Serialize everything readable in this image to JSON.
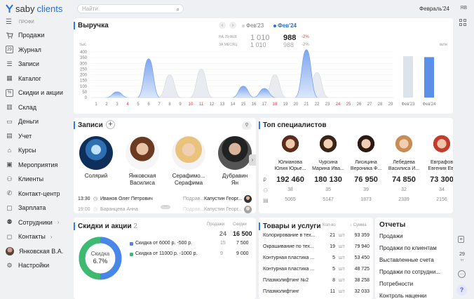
{
  "app": {
    "logo_text": "saby",
    "logo_brand": "clients"
  },
  "sidebar": {
    "section": "ПРОФИ",
    "items": [
      {
        "label": "Продажи",
        "icon": "cart-icon"
      },
      {
        "label": "Журнал",
        "icon": "calendar-icon",
        "badge": "29"
      },
      {
        "label": "Записи",
        "icon": "notes-icon"
      },
      {
        "label": "Каталог",
        "icon": "catalog-icon"
      },
      {
        "label": "Скидки и акции",
        "icon": "percent-icon"
      },
      {
        "label": "Склад",
        "icon": "warehouse-icon"
      },
      {
        "label": "Деньги",
        "icon": "wallet-icon"
      },
      {
        "label": "Учет",
        "icon": "ledger-icon"
      },
      {
        "label": "Курсы",
        "icon": "graduation-icon"
      },
      {
        "label": "Мероприятия",
        "icon": "events-icon"
      },
      {
        "label": "Клиенты",
        "icon": "clients-icon"
      },
      {
        "label": "Контакт-центр",
        "icon": "contact-center-icon"
      },
      {
        "label": "Зарплата",
        "icon": "salary-icon"
      },
      {
        "label": "Сотрудники",
        "icon": "employees-icon",
        "arrow": "›"
      },
      {
        "label": "Контакты",
        "icon": "chat-icon",
        "arrow": "›"
      },
      {
        "label": "Янковская В.А.",
        "icon": "user-avatar"
      },
      {
        "label": "Настройки",
        "icon": "gear-icon"
      }
    ]
  },
  "topbar": {
    "search_placeholder": "Найти",
    "period": "Февраль'24",
    "user_initials": "ЯВ"
  },
  "revenue": {
    "title": "Выручка",
    "legend": [
      "Фев'23",
      "Фев'24"
    ],
    "colors": {
      "prev": "#dde3ea",
      "curr": "#5b8fe8"
    },
    "rows": [
      {
        "label": "НА 29.ФЕВ",
        "prev": "1 010",
        "curr": "988",
        "delta": "-2%"
      },
      {
        "label": "ЗА МЕСЯЦ",
        "prev": "1 010",
        "curr": "988",
        "delta": "-2%"
      }
    ],
    "unit_left": "тыс",
    "unit_right": "млн",
    "bar_labels": [
      "Фев'23",
      "Фев'24"
    ]
  },
  "chart_data": {
    "type": "area",
    "x": [
      1,
      2,
      3,
      4,
      5,
      6,
      7,
      8,
      9,
      10,
      11,
      12,
      13,
      14,
      15,
      16,
      17,
      18,
      19,
      20,
      21,
      22,
      23,
      24,
      25,
      26,
      27,
      28,
      29
    ],
    "red_days": [
      4,
      10,
      11,
      17,
      18,
      24,
      25
    ],
    "series": [
      {
        "name": "Фев'24",
        "values": [
          0,
          0,
          50,
          0,
          0,
          340,
          0,
          0,
          0,
          0,
          0,
          0,
          0,
          0,
          100,
          0,
          80,
          0,
          0,
          0,
          420,
          0,
          0,
          0,
          0,
          0,
          0,
          0,
          0
        ]
      },
      {
        "name": "Фев'23",
        "values": [
          0,
          0,
          0,
          0,
          0,
          0,
          0,
          200,
          0,
          0,
          250,
          0,
          0,
          0,
          0,
          0,
          0,
          200,
          0,
          0,
          0,
          220,
          0,
          0,
          0,
          0,
          0,
          0,
          0
        ]
      }
    ],
    "ylim": [
      0,
      400
    ],
    "yticks": [
      0,
      50,
      100,
      150,
      200,
      250,
      300,
      350,
      400
    ],
    "bars": {
      "categories": [
        "Фев'23",
        "Фев'24"
      ],
      "values": [
        1.01,
        0.988
      ]
    }
  },
  "records": {
    "title": "Записи",
    "people": [
      {
        "name1": "Солярий",
        "name2": ""
      },
      {
        "name1": "Янковская",
        "name2": "Василиса"
      },
      {
        "name1": "Серафимо...",
        "name2": "Серафима"
      },
      {
        "name1": "Дубравин",
        "name2": "Ян"
      }
    ],
    "appointments": [
      {
        "time": "13:30",
        "client": "Иванов Олег Петрович",
        "service": "Подрав...",
        "master": "Капустин Георг..."
      },
      {
        "time": "19:00",
        "client": "Баранцева Анна",
        "service": "Подрав...",
        "master": "Капустин Георг..."
      }
    ]
  },
  "top": {
    "title": "Топ специалистов",
    "specialists": [
      {
        "last": "Юлианова",
        "first": "Юлия Юрье...",
        "money": "192 460",
        "clients": "38",
        "items": "5065"
      },
      {
        "last": "Чурсина",
        "first": "Марина Ива...",
        "money": "180 130",
        "clients": "35",
        "items": "5147"
      },
      {
        "last": "Лисицина",
        "first": "Вероника Ф...",
        "money": "76 950",
        "clients": "39",
        "items": "1873"
      },
      {
        "last": "Лебедева",
        "first": "Василиса И...",
        "money": "74 850",
        "clients": "32",
        "items": "2339"
      },
      {
        "last": "Евграфов",
        "first": "Евгения Евг",
        "money": "73 300",
        "clients": "34",
        "items": "2156"
      }
    ]
  },
  "discounts": {
    "title": "Скидки и акции",
    "count": "2",
    "col_sales": "Продажи",
    "col_discounts": "Скидки",
    "total_sales": "24",
    "total_discounts": "16 500",
    "donut_label": "Скидка",
    "donut_value": "6.7%",
    "donut_fraction": 0.067,
    "items": [
      {
        "label": "Скидка от 6000 р. -500 р.",
        "sales": "15",
        "discount": "7 500",
        "color": "#4a86e8"
      },
      {
        "label": "Скидка от 11000 р. -1000 р.",
        "sales": "9",
        "discount": "9 000",
        "color": "#3dba6f"
      }
    ]
  },
  "goods": {
    "title": "Товары и услуги",
    "col_qty": "Кол-во",
    "col_sum": "Сумма",
    "rows": [
      {
        "name": "Колорирование в тех...",
        "qty": "21",
        "unit": "шт",
        "sum": "93 359"
      },
      {
        "name": "Окрашивание по тех...",
        "qty": "19",
        "unit": "шт",
        "sum": "79 940"
      },
      {
        "name": "Контурная пластика ...",
        "qty": "5",
        "unit": "шт",
        "sum": "53 450"
      },
      {
        "name": "Контурная пластика ...",
        "qty": "5",
        "unit": "шт",
        "sum": "48 725"
      },
      {
        "name": "Плазмолифтинг №2",
        "qty": "8",
        "unit": "шт",
        "sum": "38 258"
      },
      {
        "name": "Плазмолифтинг",
        "qty": "11",
        "unit": "шт",
        "sum": "32 033"
      }
    ]
  },
  "reports": {
    "title": "Отчеты",
    "items": [
      "Продажи",
      "Продажи по клиентам",
      "Выставленные счета",
      "Продажи по сотрудни...",
      "Потребности",
      "Контроль наценки"
    ]
  },
  "right_rail": {
    "badge_day": "29",
    "badge_sub": "чт",
    "help": "?"
  }
}
